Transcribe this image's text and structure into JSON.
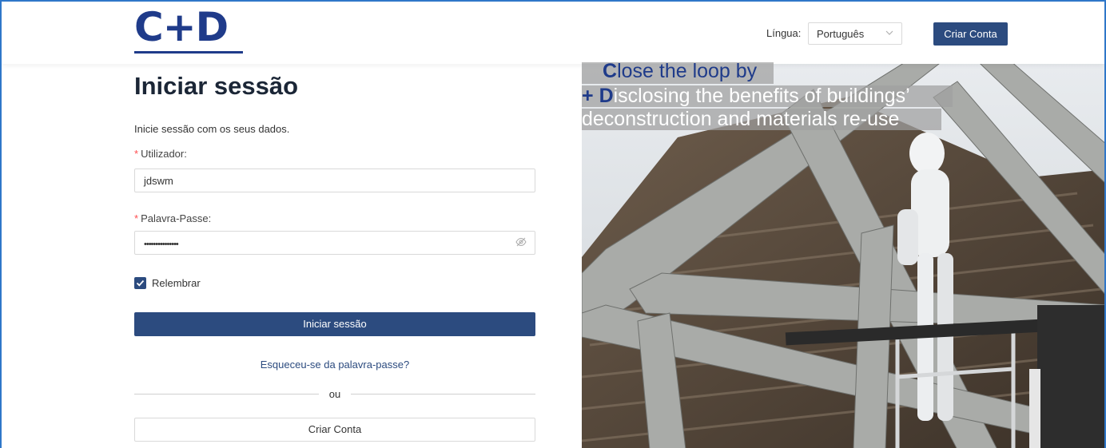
{
  "header": {
    "logo_text": "C+D",
    "language_label": "Língua",
    "language_selected": "Português",
    "create_account_label": "Criar Conta"
  },
  "form": {
    "title": "Iniciar sessão",
    "subtitle": "Inicie sessão com os seus dados.",
    "username_label": "Utilizador",
    "username_value": "jdswm",
    "password_label": "Palavra-Passe",
    "password_value": "•••••••••••••••",
    "remember_label": "Relembrar",
    "remember_checked": true,
    "login_button": "Iniciar sessão",
    "forgot_link": "Esqueceu-se da palavra-passe?",
    "divider_text": "ou",
    "create_account_button": "Criar Conta"
  },
  "banner": {
    "line1_initial": "C",
    "line1_rest": "lose the loop by",
    "line2_plus": "+",
    "line2_initial": "D",
    "line2_rest": "isclosing the benefits of buildings’",
    "line3": "deconstruction and materials re-use"
  },
  "colors": {
    "brand": "#1f3b8a",
    "primary_button": "#2c4b7f",
    "required": "#ff4d4f",
    "frame": "#2f77c9"
  },
  "icons": {
    "password_toggle": "eye-slash-icon",
    "checkbox": "check-icon",
    "select": "chevron-down-icon"
  }
}
